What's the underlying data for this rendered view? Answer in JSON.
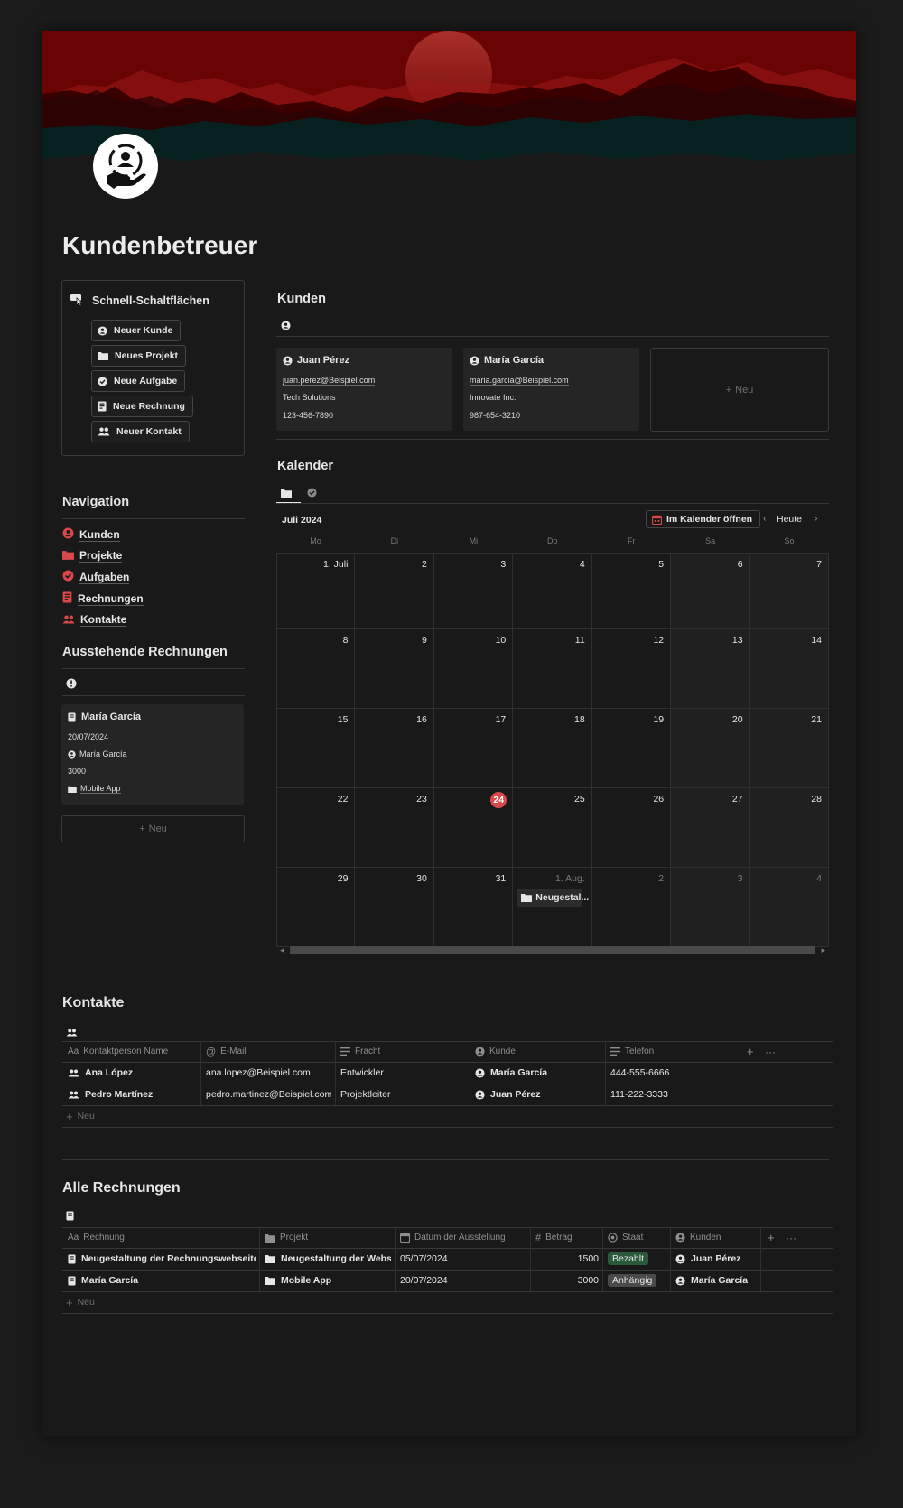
{
  "page": {
    "title": "Kundenbetreuer"
  },
  "quick": {
    "title": "Schnell-Schaltflächen",
    "buttons": [
      {
        "label": "Neuer Kunde",
        "icon": "user-circle-icon"
      },
      {
        "label": "Neues Projekt",
        "icon": "folder-icon"
      },
      {
        "label": "Neue Aufgabe",
        "icon": "check-circle-icon"
      },
      {
        "label": "Neue Rechnung",
        "icon": "receipt-icon"
      },
      {
        "label": "Neuer Kontakt",
        "icon": "people-icon"
      }
    ]
  },
  "navigation": {
    "title": "Navigation",
    "items": [
      {
        "label": "Kunden",
        "icon": "user-circle-icon"
      },
      {
        "label": "Projekte",
        "icon": "folder-icon"
      },
      {
        "label": "Aufgaben",
        "icon": "check-circle-icon"
      },
      {
        "label": "Rechnungen",
        "icon": "receipt-icon"
      },
      {
        "label": "Kontakte",
        "icon": "people-icon"
      }
    ]
  },
  "pending": {
    "title": "Ausstehende Rechnungen",
    "card": {
      "title": "María García",
      "date": "20/07/2024",
      "client": "María García",
      "amount": "3000",
      "project": "Mobile App"
    },
    "new_label": "Neu"
  },
  "kunden": {
    "title": "Kunden",
    "cards": [
      {
        "name": "Juan Pérez",
        "email": "juan.perez@Beispiel.com",
        "company": "Tech Solutions",
        "phone": "123-456-7890"
      },
      {
        "name": "María García",
        "email": "maria.garcia@Beispiel.com",
        "company": "Innovate Inc.",
        "phone": "987-654-3210"
      }
    ],
    "new_label": "Neu"
  },
  "calendar": {
    "title": "Kalender",
    "month": "Juli 2024",
    "open_label": "Im Kalender öffnen",
    "today_label": "Heute",
    "weekdays": [
      "Mo",
      "Di",
      "Mi",
      "Do",
      "Fr",
      "Sa",
      "So"
    ],
    "weeks": [
      [
        "1. Juli",
        "2",
        "3",
        "4",
        "5",
        "6",
        "7"
      ],
      [
        "8",
        "9",
        "10",
        "11",
        "12",
        "13",
        "14"
      ],
      [
        "15",
        "16",
        "17",
        "18",
        "19",
        "20",
        "21"
      ],
      [
        "22",
        "23",
        "24",
        "25",
        "26",
        "27",
        "28"
      ],
      [
        "29",
        "30",
        "31",
        "1. Aug.",
        "2",
        "3",
        "4"
      ]
    ],
    "today": "24",
    "event": "Neugestal..."
  },
  "kontakte": {
    "title": "Kontakte",
    "columns": [
      "Kontaktperson Name",
      "E-Mail",
      "Fracht",
      "Kunde",
      "Telefon"
    ],
    "rows": [
      {
        "name": "Ana López",
        "email": "ana.lopez@Beispiel.com",
        "role": "Entwickler",
        "client": "María García",
        "phone": "444-555-6666"
      },
      {
        "name": "Pedro Martínez",
        "email": "pedro.martinez@Beispiel.com",
        "role": "Projektleiter",
        "client": "Juan Pérez",
        "phone": "111-222-3333"
      }
    ],
    "new_label": "Neu"
  },
  "rechnungen": {
    "title": "Alle Rechnungen",
    "columns": [
      "Rechnung",
      "Projekt",
      "Datum der Ausstellung",
      "Betrag",
      "Staat",
      "Kunden"
    ],
    "rows": [
      {
        "name": "Neugestaltung der Rechnungswebseite",
        "project": "Neugestaltung der Websit",
        "date": "05/07/2024",
        "amount": "1500",
        "status": "Bezahlt",
        "client": "Juan Pérez"
      },
      {
        "name": "María García",
        "project": "Mobile App",
        "date": "20/07/2024",
        "amount": "3000",
        "status": "Anhängig",
        "client": "María García"
      }
    ],
    "new_label": "Neu"
  },
  "colors": {
    "accent_red": "#d9484a",
    "paid_bg": "#2b5a3a",
    "pending_bg": "#4a4a4a"
  }
}
